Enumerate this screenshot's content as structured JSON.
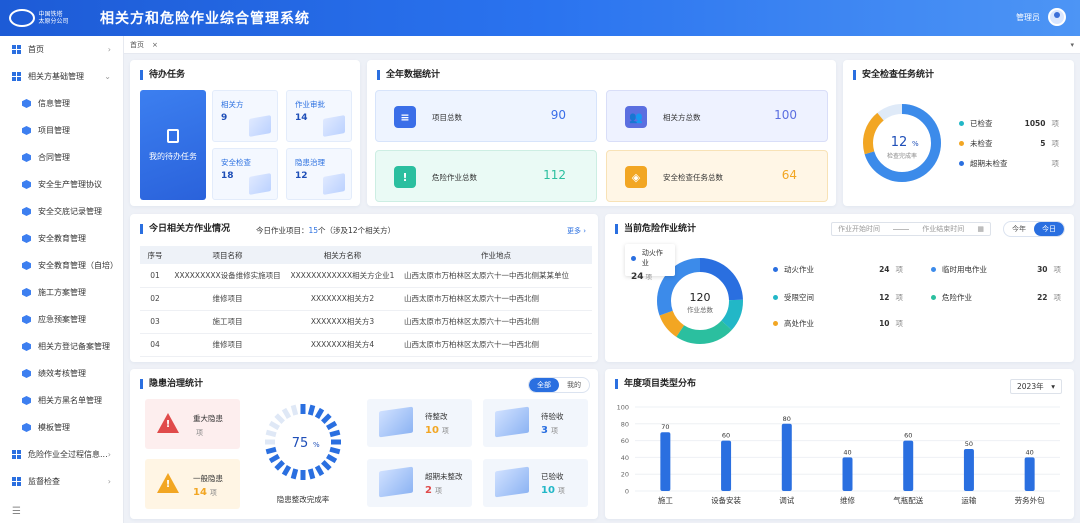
{
  "header": {
    "title": "相关方和危险作业综合管理系统",
    "logo_line1": "中国铁塔",
    "logo_line2": "太原分公司",
    "user": "管理员"
  },
  "sidebar": {
    "items": [
      {
        "label": "首页",
        "level": 0,
        "icon": "grid-icon",
        "arrow": "›"
      },
      {
        "label": "相关方基础管理",
        "level": 0,
        "icon": "grid-icon",
        "arrow": "⌄"
      },
      {
        "label": "信息管理",
        "level": 1,
        "icon": "cube-icon"
      },
      {
        "label": "项目管理",
        "level": 1,
        "icon": "cube-icon"
      },
      {
        "label": "合同管理",
        "level": 1,
        "icon": "cube-icon"
      },
      {
        "label": "安全生产管理协议",
        "level": 1,
        "icon": "cube-icon"
      },
      {
        "label": "安全交底记录管理",
        "level": 1,
        "icon": "cube-icon"
      },
      {
        "label": "安全教育管理",
        "level": 1,
        "icon": "cube-icon"
      },
      {
        "label": "安全教育管理（自培）",
        "level": 1,
        "icon": "cube-icon"
      },
      {
        "label": "施工方案管理",
        "level": 1,
        "icon": "cube-icon"
      },
      {
        "label": "应急预案管理",
        "level": 1,
        "icon": "cube-icon"
      },
      {
        "label": "相关方登记备案管理",
        "level": 1,
        "icon": "cube-icon"
      },
      {
        "label": "绩效考核管理",
        "level": 1,
        "icon": "cube-icon"
      },
      {
        "label": "相关方黑名单管理",
        "level": 1,
        "icon": "cube-icon"
      },
      {
        "label": "模板管理",
        "level": 1,
        "icon": "cube-icon"
      },
      {
        "label": "危险作业全过程信息...",
        "level": 0,
        "icon": "grid-icon",
        "arrow": "›"
      },
      {
        "label": "监督检查",
        "level": 0,
        "icon": "grid-icon",
        "arrow": "›"
      }
    ],
    "collapse_icon": "☰"
  },
  "tabs": {
    "home": "首页",
    "close": "×",
    "dropdown": "▾"
  },
  "todo": {
    "title": "待办任务",
    "main_label": "我的待办任务",
    "cells": [
      {
        "label": "相关方",
        "value": "9"
      },
      {
        "label": "作业审批",
        "value": "14"
      },
      {
        "label": "安全检查",
        "value": "18"
      },
      {
        "label": "隐患治理",
        "value": "12"
      }
    ]
  },
  "annual": {
    "title": "全年数据统计",
    "stats": [
      {
        "label": "项目总数",
        "value": "90",
        "color": "#3a6ee8"
      },
      {
        "label": "相关方总数",
        "value": "100",
        "color": "#5b6fe0"
      },
      {
        "label": "危险作业总数",
        "value": "112",
        "color": "#2bbf9f"
      },
      {
        "label": "安全检查任务总数",
        "value": "64",
        "color": "#f2a623"
      }
    ]
  },
  "safety": {
    "title": "安全检查任务统计",
    "pct": "12",
    "pct_unit": "%",
    "center_label": "检查完成率",
    "rows": [
      {
        "label": "已检查",
        "value": "1050",
        "unit": "项",
        "color": "#22b7c7"
      },
      {
        "label": "未检查",
        "value": "5",
        "unit": "项",
        "color": "#f2a623"
      },
      {
        "label": "超期未检查",
        "value": "",
        "unit": "项",
        "color": "#2a6fe0"
      }
    ]
  },
  "today": {
    "title": "今日相关方作业情况",
    "subtitle_prefix": "今日作业项目：",
    "subtitle_count": "15",
    "subtitle_suffix": "个（涉及12个相关方）",
    "more": "更多 ›",
    "columns": [
      "序号",
      "项目名称",
      "相关方名称",
      "作业地点"
    ],
    "rows": [
      [
        "01",
        "XXXXXXXXX设备维修实施项目",
        "XXXXXXXXXXXX相关方企业1",
        "山西太原市万柏林区太原六十一中西北侧某某单位"
      ],
      [
        "02",
        "维修项目",
        "XXXXXXX相关方2",
        "山西太原市万柏林区太原六十一中西北侧"
      ],
      [
        "03",
        "施工项目",
        "XXXXXXX相关方3",
        "山西太原市万柏林区太原六十一中西北侧"
      ],
      [
        "04",
        "维修项目",
        "XXXXXXX相关方4",
        "山西太原市万柏林区太原六十一中西北侧"
      ]
    ]
  },
  "danger": {
    "title": "当前危险作业统计",
    "start_placeholder": "作业开始时间",
    "end_placeholder": "作业结束时间",
    "toggle": [
      "今年",
      "今日"
    ],
    "total": "120",
    "total_label": "作业总数",
    "tooltip_label": "动火作业",
    "tooltip_value": "24",
    "tooltip_unit": "项",
    "items": [
      {
        "label": "动火作业",
        "value": "24",
        "unit": "项",
        "color": "#2a6fe0"
      },
      {
        "label": "临时用电作业",
        "value": "30",
        "unit": "项",
        "color": "#3c8bea"
      },
      {
        "label": "受限空间",
        "value": "12",
        "unit": "项",
        "color": "#22b7c7"
      },
      {
        "label": "危险作业",
        "value": "22",
        "unit": "项",
        "color": "#2bbf9f"
      },
      {
        "label": "高处作业",
        "value": "10",
        "unit": "项",
        "color": "#f2a623"
      }
    ]
  },
  "hazard": {
    "title": "隐患治理统计",
    "toggle": [
      "全部",
      "我的"
    ],
    "major": {
      "label": "重大隐患",
      "value": "",
      "unit": "项"
    },
    "minor": {
      "label": "一般隐患",
      "value": "14",
      "unit": "项"
    },
    "rate": "75",
    "rate_unit": "%",
    "rate_label": "隐患整改完成率",
    "items": [
      {
        "label": "待整改",
        "value": "10",
        "unit": "项",
        "color": "#f2a623"
      },
      {
        "label": "待验收",
        "value": "3",
        "unit": "项",
        "color": "#2a6fe0"
      },
      {
        "label": "超期未整改",
        "value": "2",
        "unit": "项",
        "color": "#e04b4b"
      },
      {
        "label": "已验收",
        "value": "10",
        "unit": "项",
        "color": "#22b7c7"
      }
    ]
  },
  "chart_data": {
    "type": "bar",
    "title": "年度项目类型分布",
    "year": "2023年",
    "categories": [
      "施工",
      "设备安装",
      "调试",
      "维修",
      "气瓶配送",
      "运输",
      "劳务外包"
    ],
    "values": [
      70,
      60,
      80,
      40,
      60,
      50,
      40
    ],
    "ylim": [
      0,
      100
    ],
    "yticks": [
      0,
      20,
      40,
      60,
      80,
      100
    ],
    "color": "#2a6fe0"
  }
}
